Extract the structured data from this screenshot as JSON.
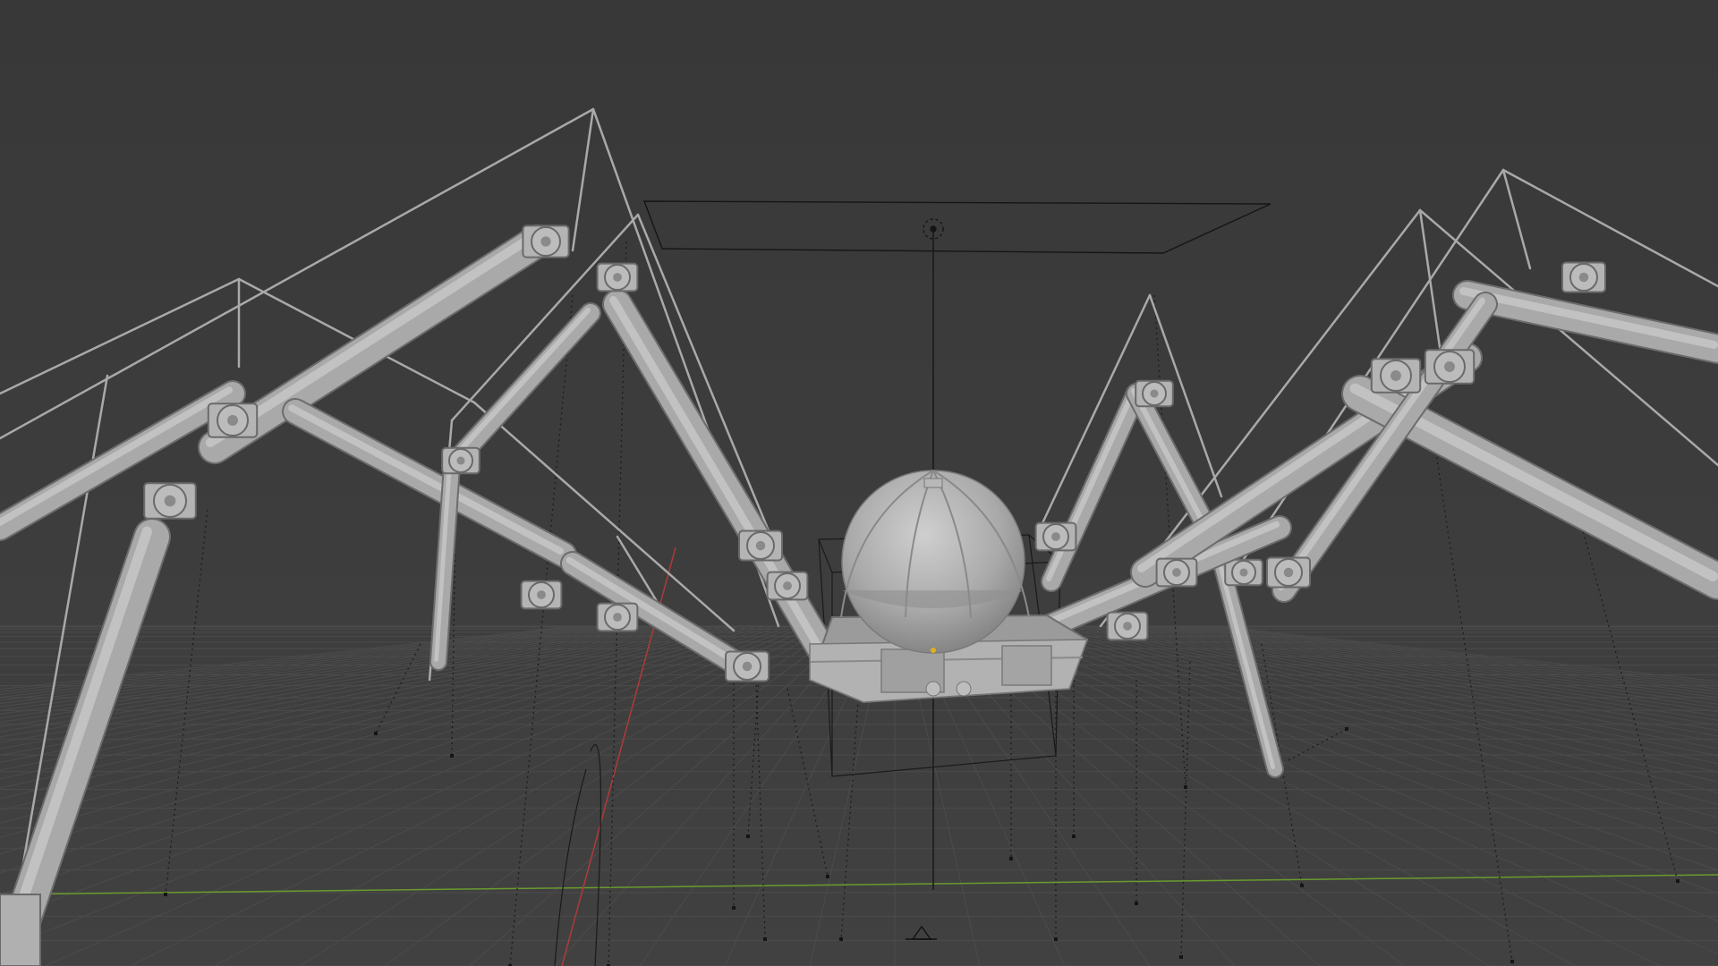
{
  "viewport": {
    "background_top": "#3a3a3a",
    "background_bottom": "#404040",
    "grid_color": "#4a4a4a",
    "x_axis_color": "#b03a3a",
    "y_axis_color": "#6a9a2e",
    "mesh_color": "#a6a6a6",
    "mesh_shadow": "#6e6e6e",
    "wire_color": "#111111",
    "origin_dot_color": "#e0b020"
  },
  "scene": {
    "object": "spider-rig",
    "light": "spot-light",
    "empties": "bounding-boxes",
    "camera": "camera-icon"
  }
}
